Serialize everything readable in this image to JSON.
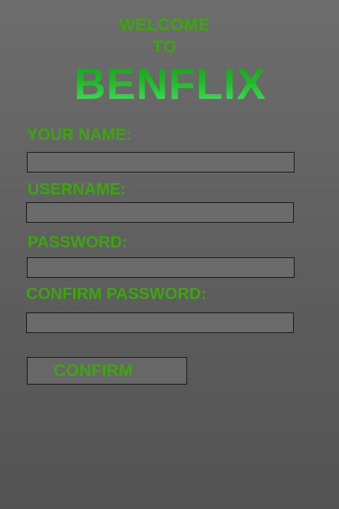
{
  "header": {
    "welcome_line1": "WELCOME",
    "welcome_line2": "TO",
    "brand": "BENFLIX"
  },
  "form": {
    "name_label": "YOUR NAME:",
    "name_value": "",
    "username_label": "USERNAME:",
    "username_value": "",
    "password_label": "PASSWORD:",
    "password_value": "",
    "confirm_password_label": "CONFIRM PASSWORD:",
    "confirm_password_value": "",
    "confirm_button_label": "CONFIRM"
  },
  "colors": {
    "accent_green": "#3aa70a",
    "background_top": "#6d6d6d",
    "background_bottom": "#535353",
    "field_border": "#111111"
  }
}
